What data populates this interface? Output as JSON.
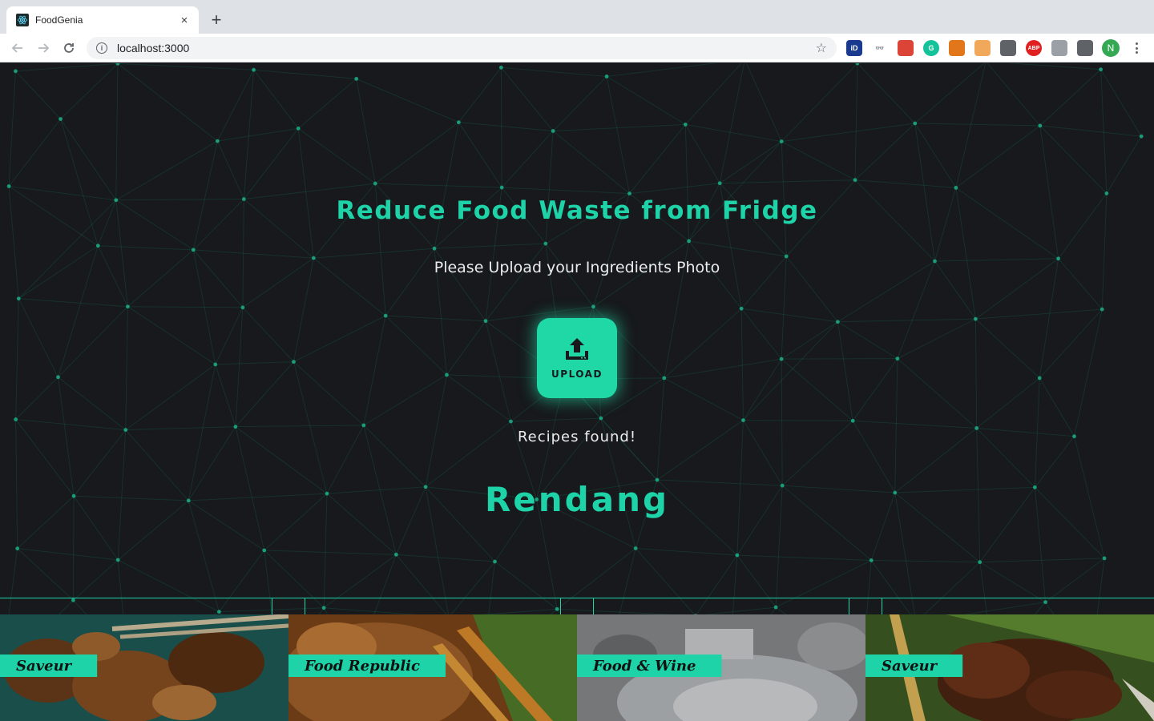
{
  "browser": {
    "tab_title": "FoodGenia",
    "close_glyph": "×",
    "new_tab_glyph": "+",
    "url": "localhost:3000",
    "star_glyph": "☆",
    "profile_initial": "N",
    "extensions": [
      {
        "name": "id-extension-icon",
        "label": "iD",
        "color": "#1a3a8f"
      },
      {
        "name": "disguise-extension-icon",
        "label": "👓",
        "color": "#ffffff"
      },
      {
        "name": "google-translate-extension-icon",
        "label": "",
        "color": "#db4437"
      },
      {
        "name": "grammarly-extension-icon",
        "label": "G",
        "color": "#15c39a"
      },
      {
        "name": "metamask-extension-icon",
        "label": "",
        "color": "#e2761b"
      },
      {
        "name": "box-extension-icon",
        "label": "",
        "color": "#f1a85a"
      },
      {
        "name": "qr-extension-icon",
        "label": "",
        "color": "#5f6368"
      },
      {
        "name": "adblock-extension-icon",
        "label": "ABP",
        "color": "#e02020"
      },
      {
        "name": "bike-extension-icon",
        "label": "",
        "color": "#9aa0a6"
      },
      {
        "name": "puzzle-extension-icon",
        "label": "",
        "color": "#5f6368"
      }
    ]
  },
  "hero": {
    "headline": "Reduce Food Waste from Fridge",
    "subline": "Please Upload your Ingredients Photo",
    "upload_label": "UPLOAD",
    "found_text": "Recipes found!",
    "recipe_name": "Rendang"
  },
  "colors": {
    "accent": "#1dd3a7",
    "background": "#17191c",
    "text": "#ececec"
  },
  "cards": [
    {
      "source": "Saveur"
    },
    {
      "source": "Food Republic"
    },
    {
      "source": "Food & Wine"
    },
    {
      "source": "Saveur"
    }
  ]
}
